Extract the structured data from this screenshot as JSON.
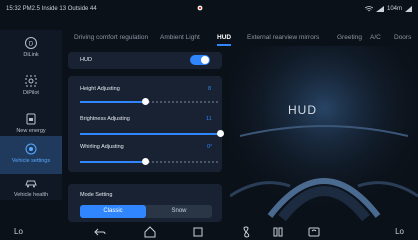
{
  "status": {
    "left_text": "15:32 PM2.5 Inside 13 Outside 44",
    "right_text": "104m"
  },
  "sidebar": {
    "items": [
      {
        "label": "DiLink",
        "icon": "d-logo-icon"
      },
      {
        "label": "DiPilot",
        "icon": "steering-wheel-icon"
      },
      {
        "label": "New energy",
        "icon": "battery-icon"
      },
      {
        "label": "Vehicle settings",
        "icon": "car-settings-icon",
        "active": true
      },
      {
        "label": "Vehicle health",
        "icon": "car-health-icon"
      }
    ]
  },
  "tabs": [
    {
      "label": "Driving comfort regulation"
    },
    {
      "label": "Ambient Light"
    },
    {
      "label": "HUD",
      "active": true
    },
    {
      "label": "External rearview mirrors"
    },
    {
      "label": "Greeting"
    },
    {
      "label": "A/C"
    },
    {
      "label": "Doors"
    }
  ],
  "hud": {
    "label": "HUD",
    "enabled": true
  },
  "sliders": {
    "height": {
      "label": "Height Adjusting",
      "value": "8",
      "fraction": 0.47
    },
    "brightness": {
      "label": "Brightness Adjusting",
      "value": "11",
      "fraction": 1.0
    },
    "whirling": {
      "label": "Whirling Adjusting",
      "value": "0°",
      "fraction": 0.47
    }
  },
  "mode": {
    "label": "Mode Setting",
    "options": [
      "Classic",
      "Snow"
    ],
    "selected": "Classic"
  },
  "preview": {
    "hud_text": "HUD"
  },
  "navbar": {
    "left_temp": "Lo",
    "right_temp": "Lo"
  },
  "colors": {
    "accent": "#2f86ff",
    "background": "#0b1119",
    "panel": "#182232"
  }
}
